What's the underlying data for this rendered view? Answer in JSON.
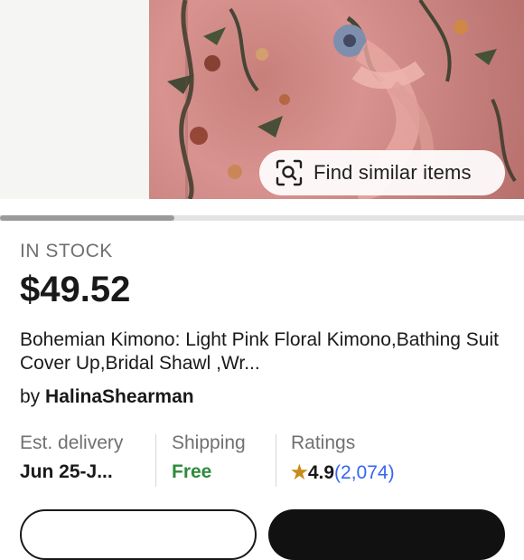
{
  "hero": {
    "similar_label": "Find similar items"
  },
  "listing": {
    "stock": "IN STOCK",
    "price": "$49.52",
    "title": "Bohemian Kimono: Light Pink Floral Kimono,Bathing Suit Cover Up,Bridal Shawl ,Wr...",
    "seller_prefix": "by",
    "seller_name": "HalinaShearman"
  },
  "stats": {
    "delivery_label": "Est. delivery",
    "delivery_value": "Jun 25-J...",
    "shipping_label": "Shipping",
    "shipping_value": "Free",
    "ratings_label": "Ratings",
    "ratings_star": "★",
    "ratings_value": "4.9",
    "ratings_count": "(2,074)"
  },
  "colors": {
    "accent_link": "#3665f3",
    "free_green": "#2f8a3c",
    "star_gold": "#c98b18"
  },
  "icons": {
    "similar": "image-search-icon"
  }
}
